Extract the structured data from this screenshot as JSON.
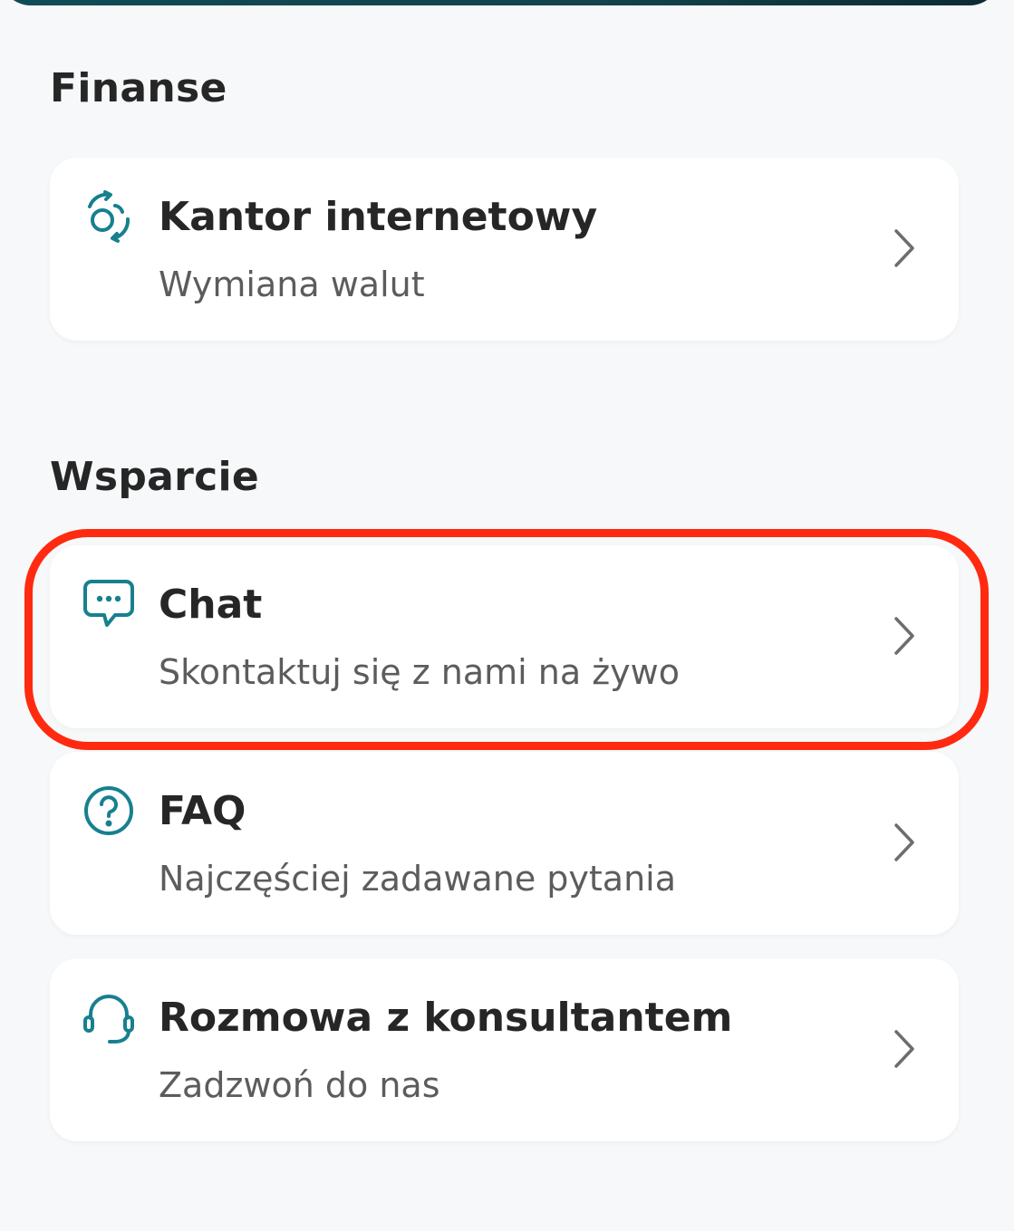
{
  "sections": [
    {
      "title": "Finanse",
      "items": [
        {
          "icon": "currency-exchange-icon",
          "title": "Kantor internetowy",
          "subtitle": "Wymiana walut"
        }
      ]
    },
    {
      "title": "Wsparcie",
      "items": [
        {
          "icon": "chat-bubble-icon",
          "title": "Chat",
          "subtitle": "Skontaktuj się z nami na żywo"
        },
        {
          "icon": "question-circle-icon",
          "title": "FAQ",
          "subtitle": "Najczęściej zadawane pytania"
        },
        {
          "icon": "headset-icon",
          "title": "Rozmowa z konsultantem",
          "subtitle": "Zadzwoń do nas"
        }
      ]
    }
  ],
  "colors": {
    "accent": "#17808f",
    "highlight": "#ff2a10",
    "background": "#f6f8f9",
    "card": "#ffffff"
  }
}
